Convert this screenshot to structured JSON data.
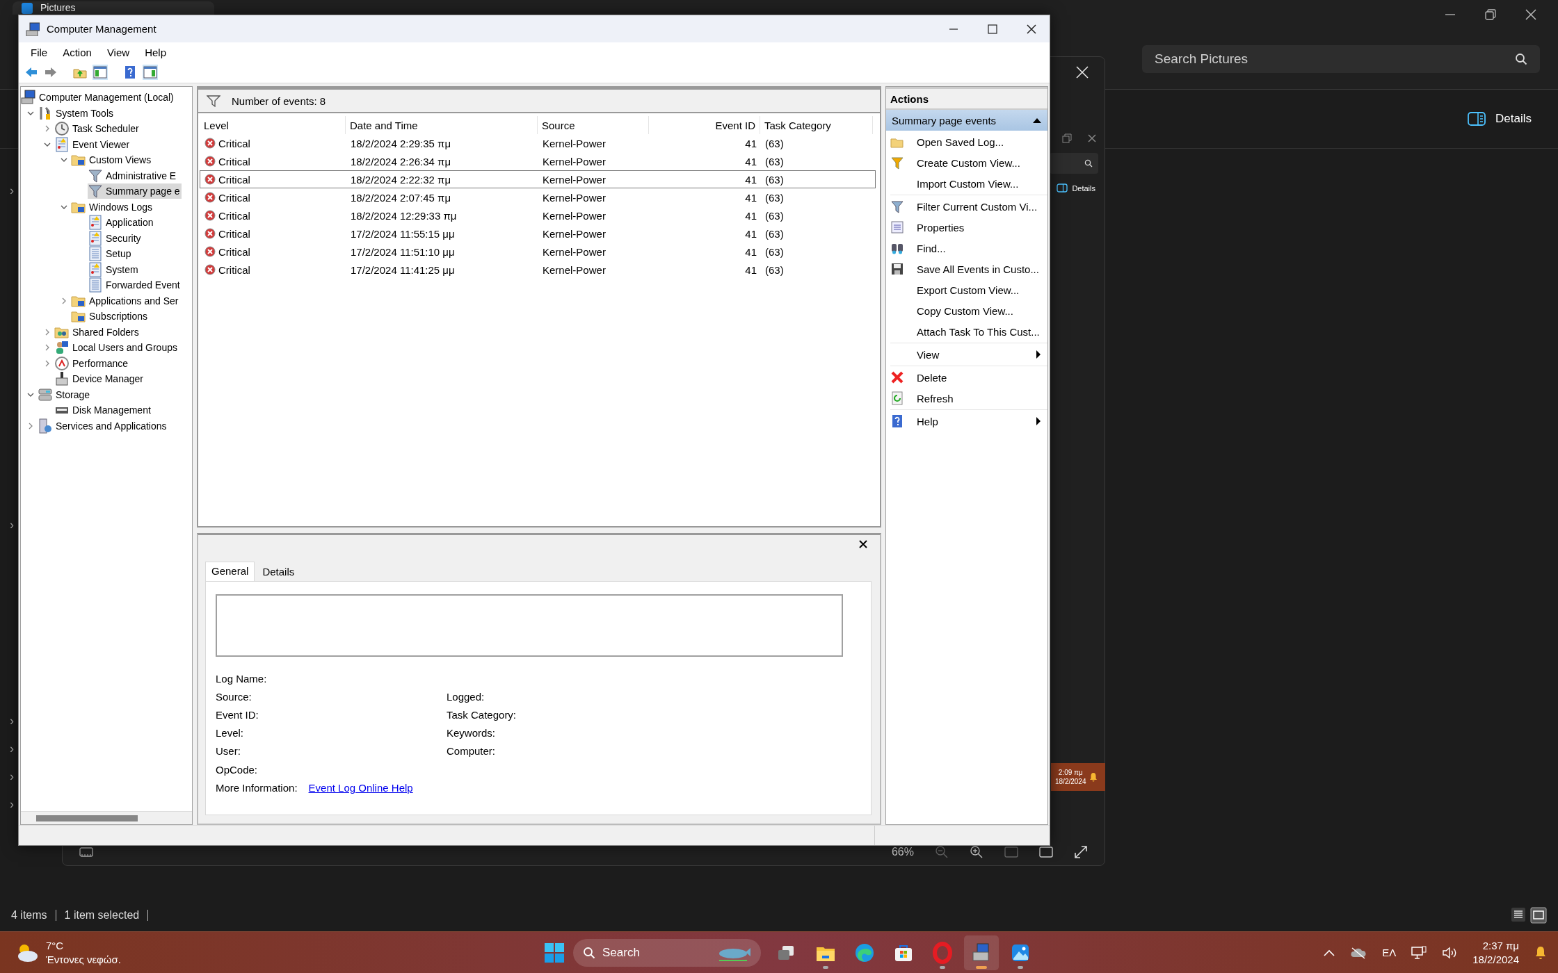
{
  "pictures_window": {
    "tab_title": "Pictures",
    "search": {
      "placeholder": "Search Pictures"
    },
    "details_button": "Details",
    "side_chevrons": [
      "›",
      "›",
      "›",
      "›",
      "›",
      "›"
    ],
    "status": [
      "4 items",
      "1 item selected"
    ]
  },
  "viewer_window": {
    "details_button": "Details",
    "notification": {
      "time": "2:09 πμ",
      "date": "18/2/2024"
    },
    "zoom": "66%"
  },
  "window": {
    "title": "Computer Management",
    "menu": [
      "File",
      "Action",
      "View",
      "Help"
    ]
  },
  "tree": [
    {
      "label": "Computer Management (Local)",
      "kind": "computer",
      "selected": false,
      "children": [
        {
          "label": "System Tools",
          "kind": "tools",
          "expanded": true,
          "selected": false,
          "children": [
            {
              "label": "Task Scheduler",
              "kind": "clock",
              "expanded": false,
              "selected": false
            },
            {
              "label": "Event Viewer",
              "kind": "log",
              "expanded": true,
              "selected": false,
              "children": [
                {
                  "label": "Custom Views",
                  "kind": "folder",
                  "expanded": true,
                  "selected": false,
                  "children": [
                    {
                      "label": "Administrative E",
                      "kind": "filter",
                      "selected": false
                    },
                    {
                      "label": "Summary page e",
                      "kind": "filter",
                      "selected": true
                    }
                  ]
                },
                {
                  "label": "Windows Logs",
                  "kind": "folder",
                  "expanded": true,
                  "selected": false,
                  "children": [
                    {
                      "label": "Application",
                      "kind": "log",
                      "selected": false
                    },
                    {
                      "label": "Security",
                      "kind": "log",
                      "selected": false
                    },
                    {
                      "label": "Setup",
                      "kind": "page",
                      "selected": false
                    },
                    {
                      "label": "System",
                      "kind": "log",
                      "selected": false
                    },
                    {
                      "label": "Forwarded Event",
                      "kind": "page",
                      "selected": false
                    }
                  ]
                },
                {
                  "label": "Applications and Ser",
                  "kind": "folder",
                  "expanded": false,
                  "selected": false
                },
                {
                  "label": "Subscriptions",
                  "kind": "folder",
                  "selected": false
                }
              ]
            },
            {
              "label": "Shared Folders",
              "kind": "share",
              "expanded": false,
              "selected": false
            },
            {
              "label": "Local Users and Groups",
              "kind": "users",
              "expanded": false,
              "selected": false
            },
            {
              "label": "Performance",
              "kind": "gauge",
              "expanded": false,
              "selected": false
            },
            {
              "label": "Device Manager",
              "kind": "device",
              "selected": false
            }
          ]
        },
        {
          "label": "Storage",
          "kind": "storage",
          "expanded": true,
          "selected": false,
          "children": [
            {
              "label": "Disk Management",
              "kind": "disk",
              "selected": false
            }
          ]
        },
        {
          "label": "Services and Applications",
          "kind": "services",
          "expanded": false,
          "selected": false
        }
      ]
    }
  ],
  "events": {
    "summary": "Number of events: 8",
    "columns": [
      "Level",
      "Date and Time",
      "Source",
      "Event ID",
      "Task Category"
    ],
    "rows": [
      {
        "level": "Critical",
        "kind": "critical",
        "date": "18/2/2024 2:29:35 πμ",
        "source": "Kernel-Power",
        "event_id": "41",
        "task_category": "(63)",
        "selected": false
      },
      {
        "level": "Critical",
        "kind": "critical",
        "date": "18/2/2024 2:26:34 πμ",
        "source": "Kernel-Power",
        "event_id": "41",
        "task_category": "(63)",
        "selected": false
      },
      {
        "level": "Critical",
        "kind": "critical",
        "date": "18/2/2024 2:22:32 πμ",
        "source": "Kernel-Power",
        "event_id": "41",
        "task_category": "(63)",
        "selected": true
      },
      {
        "level": "Critical",
        "kind": "critical",
        "date": "18/2/2024 2:07:45 πμ",
        "source": "Kernel-Power",
        "event_id": "41",
        "task_category": "(63)",
        "selected": false
      },
      {
        "level": "Critical",
        "kind": "critical",
        "date": "18/2/2024 12:29:33 πμ",
        "source": "Kernel-Power",
        "event_id": "41",
        "task_category": "(63)",
        "selected": false
      },
      {
        "level": "Critical",
        "kind": "critical",
        "date": "17/2/2024 11:55:15 μμ",
        "source": "Kernel-Power",
        "event_id": "41",
        "task_category": "(63)",
        "selected": false
      },
      {
        "level": "Critical",
        "kind": "critical",
        "date": "17/2/2024 11:51:10 μμ",
        "source": "Kernel-Power",
        "event_id": "41",
        "task_category": "(63)",
        "selected": false
      },
      {
        "level": "Critical",
        "kind": "critical",
        "date": "17/2/2024 11:41:25 μμ",
        "source": "Kernel-Power",
        "event_id": "41",
        "task_category": "(63)",
        "selected": false
      }
    ]
  },
  "detail": {
    "tabs": [
      {
        "label": "General",
        "selected": true
      },
      {
        "label": "Details",
        "selected": false
      }
    ],
    "field_rows": [
      [
        "Log Name:"
      ],
      [
        "Source:",
        "Logged:"
      ],
      [
        "Event ID:",
        "Task Category:"
      ],
      [
        "Level:",
        "Keywords:"
      ],
      [
        "User:",
        "Computer:"
      ],
      [
        "OpCode:"
      ]
    ],
    "more_information": {
      "label": "More Information:",
      "link": "Event Log Online Help"
    }
  },
  "actions": {
    "title": "Actions",
    "section": {
      "label": "Summary page events",
      "expanded": true
    },
    "groups": [
      [
        {
          "label": "Open Saved Log...",
          "kind": "open"
        },
        {
          "label": "Create Custom View...",
          "kind": "create-filter"
        },
        {
          "label": "Import Custom View...",
          "kind": "none"
        }
      ],
      [
        {
          "label": "Filter Current Custom Vi...",
          "kind": "filter"
        },
        {
          "label": "Properties",
          "kind": "properties"
        },
        {
          "label": "Find...",
          "kind": "find"
        },
        {
          "label": "Save All Events in Custo...",
          "kind": "save"
        },
        {
          "label": "Export Custom View...",
          "kind": "none"
        },
        {
          "label": "Copy Custom View...",
          "kind": "none"
        },
        {
          "label": "Attach Task To This Cust...",
          "kind": "none"
        }
      ],
      [
        {
          "label": "View",
          "kind": "none",
          "submenu": true
        }
      ],
      [
        {
          "label": "Delete",
          "kind": "delete"
        },
        {
          "label": "Refresh",
          "kind": "refresh"
        }
      ],
      [
        {
          "label": "Help",
          "kind": "help",
          "submenu": true
        }
      ]
    ]
  },
  "taskbar": {
    "weather": {
      "temperature": "7°C",
      "condition": "Έντονες νεφώσ."
    },
    "search": {
      "label": "Search"
    },
    "apps": [
      {
        "kind": "task-view",
        "running": false,
        "active": false
      },
      {
        "kind": "explorer",
        "running": true,
        "active": false
      },
      {
        "kind": "edge",
        "running": false,
        "active": false
      },
      {
        "kind": "store",
        "running": false,
        "active": false
      },
      {
        "kind": "opera",
        "running": true,
        "active": false
      },
      {
        "kind": "computer-management",
        "running": true,
        "active": true
      },
      {
        "kind": "photos",
        "running": true,
        "active": false
      }
    ],
    "tray": {
      "language": "ΕΛ",
      "time": "2:37 πμ",
      "date": "18/2/2024"
    }
  }
}
